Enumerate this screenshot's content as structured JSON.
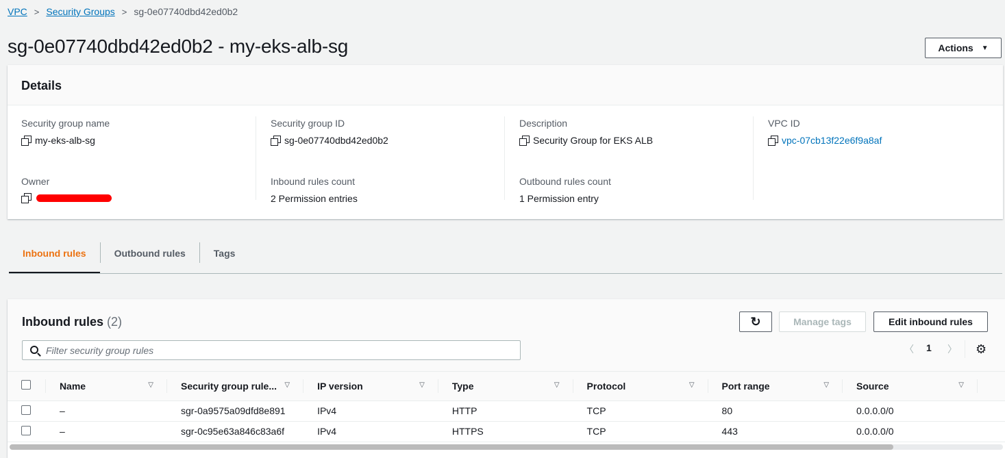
{
  "breadcrumb": {
    "items": [
      "VPC",
      "Security Groups"
    ],
    "current": "sg-0e07740dbd42ed0b2",
    "separator": ">"
  },
  "page_title": "sg-0e07740dbd42ed0b2 - my-eks-alb-sg",
  "actions_label": "Actions",
  "details": {
    "title": "Details",
    "sg_name_label": "Security group name",
    "sg_name_value": "my-eks-alb-sg",
    "sg_id_label": "Security group ID",
    "sg_id_value": "sg-0e07740dbd42ed0b2",
    "description_label": "Description",
    "description_value": "Security Group for EKS ALB",
    "vpc_id_label": "VPC ID",
    "vpc_id_value": "vpc-07cb13f22e6f9a8af",
    "owner_label": "Owner",
    "inbound_count_label": "Inbound rules count",
    "inbound_count_value": "2 Permission entries",
    "outbound_count_label": "Outbound rules count",
    "outbound_count_value": "1 Permission entry"
  },
  "tabs": [
    "Inbound rules",
    "Outbound rules",
    "Tags"
  ],
  "rules": {
    "title": "Inbound rules",
    "count": "(2)",
    "manage_tags_label": "Manage tags",
    "edit_label": "Edit inbound rules",
    "filter_placeholder": "Filter security group rules",
    "page": "1",
    "columns": [
      "Name",
      "Security group rule...",
      "IP version",
      "Type",
      "Protocol",
      "Port range",
      "Source"
    ],
    "rows": [
      [
        "–",
        "sgr-0a9575a09dfd8e891",
        "IPv4",
        "HTTP",
        "TCP",
        "80",
        "0.0.0.0/0"
      ],
      [
        "–",
        "sgr-0c95e63a846c83a6f",
        "IPv4",
        "HTTPS",
        "TCP",
        "443",
        "0.0.0.0/0"
      ]
    ]
  },
  "colors": {
    "accent_tab": "#ec7211",
    "link": "#0073bb",
    "redaction": "#ff0000"
  },
  "icons": [
    "copy-icon",
    "refresh-icon",
    "search-icon",
    "chevron-left-icon",
    "chevron-right-icon",
    "gear-icon",
    "sort-icon",
    "caret-down-icon"
  ]
}
